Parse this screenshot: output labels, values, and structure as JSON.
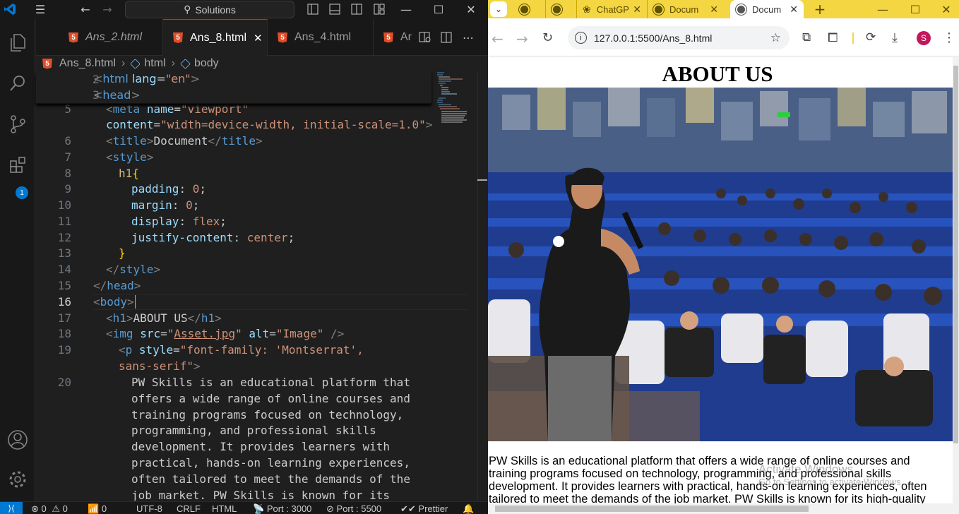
{
  "vscode": {
    "search_label": "Solutions",
    "tabs": [
      {
        "name": "Ans_2.html",
        "close": ""
      },
      {
        "name": "Ans_8.html",
        "close": "✕"
      },
      {
        "name": "Ans_4.html",
        "close": ""
      },
      {
        "name": "Ar",
        "close": ""
      }
    ],
    "breadcrumb": [
      "Ans_8.html",
      "html",
      "body"
    ],
    "extensions_badge": "1",
    "line_numbers": [
      "2",
      "3",
      "5",
      "",
      "6",
      "7",
      "8",
      "9",
      "10",
      "11",
      "12",
      "13",
      "14",
      "15",
      "16",
      "17",
      "18",
      "19",
      "",
      "20",
      "",
      "",
      "",
      "",
      "",
      "",
      ""
    ],
    "code": {
      "l2_attr_val": "\"en\"",
      "l5_attr_val": "\"viewport\"",
      "l5b_attr_val": "\"width=device-width, initial-scale=1.0\"",
      "l6_text": "Document",
      "l8_sel": "h1",
      "l9": [
        "padding",
        "0"
      ],
      "l10": [
        "margin",
        "0"
      ],
      "l11": [
        "display",
        "flex"
      ],
      "l12": [
        "justify-content",
        "center"
      ],
      "l17_text": "ABOUT US",
      "l18_src": "Asset.jpg",
      "l18_alt": "\"Image\"",
      "l19_style": "\"font-family: 'Montserrat',",
      "l19b_style": "sans-serif\"",
      "para_lines": [
        "PW Skills is an educational platform that",
        "offers a wide range of online courses and",
        "training programs focused on technology,",
        "programming, and professional skills",
        "development. It provides learners with",
        "practical, hands-on learning experiences,",
        "often tailored to meet the demands of the",
        "job market. PW Skills is known for its"
      ]
    },
    "status": {
      "errors": "0",
      "warnings": "0",
      "ports": "0",
      "encoding": "UTF-8",
      "eol": "CRLF",
      "language": "HTML",
      "live_port": "Port : 3000",
      "go_live": "Port : 5500",
      "formatter": "Prettier"
    }
  },
  "browser": {
    "tabs": [
      {
        "title": ""
      },
      {
        "title": ""
      },
      {
        "title": "ChatGP"
      },
      {
        "title": "Docum"
      },
      {
        "title": "Docum"
      }
    ],
    "url": "127.0.0.1:5500/Ans_8.html",
    "profile_initial": "S",
    "accent": "#f4d542",
    "page": {
      "heading": "ABOUT US",
      "image_alt": "Image",
      "paragraph": "PW Skills is an educational platform that offers a wide range of online courses and training programs focused on technology, programming, and professional skills development. It provides learners with practical, hands-on learning experiences, often tailored to meet the demands of the job market. PW Skills is known for its high-quality content, experienced"
    },
    "watermark": [
      "Activate Windows",
      "Go to Settings to activate Windows."
    ]
  }
}
